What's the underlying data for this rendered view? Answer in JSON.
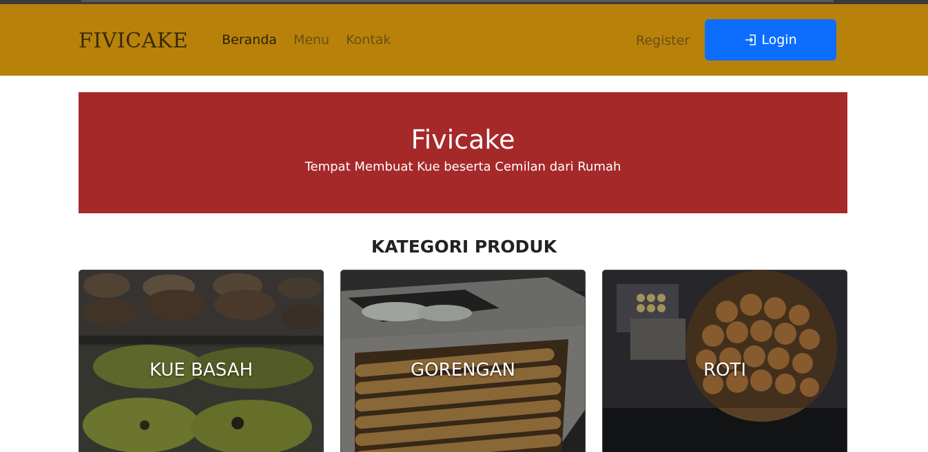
{
  "navbar": {
    "brand": "FIVICAKE",
    "links": [
      {
        "label": "Beranda",
        "active": true
      },
      {
        "label": "Menu",
        "active": false
      },
      {
        "label": "Kontak",
        "active": false
      }
    ],
    "register_label": "Register",
    "login_label": "Login",
    "bg_color": "#b8820a",
    "login_color": "#0d6efd"
  },
  "hero": {
    "title": "Fivicake",
    "subtitle": "Tempat Membuat Kue beserta Cemilan dari Rumah",
    "bg_color": "#a6292a"
  },
  "categories": {
    "heading": "KATEGORI PRODUK",
    "items": [
      {
        "label": "KUE BASAH",
        "image": "kue-basah-photo"
      },
      {
        "label": "GORENGAN",
        "image": "gorengan-photo"
      },
      {
        "label": "ROTI",
        "image": "roti-photo"
      }
    ]
  }
}
